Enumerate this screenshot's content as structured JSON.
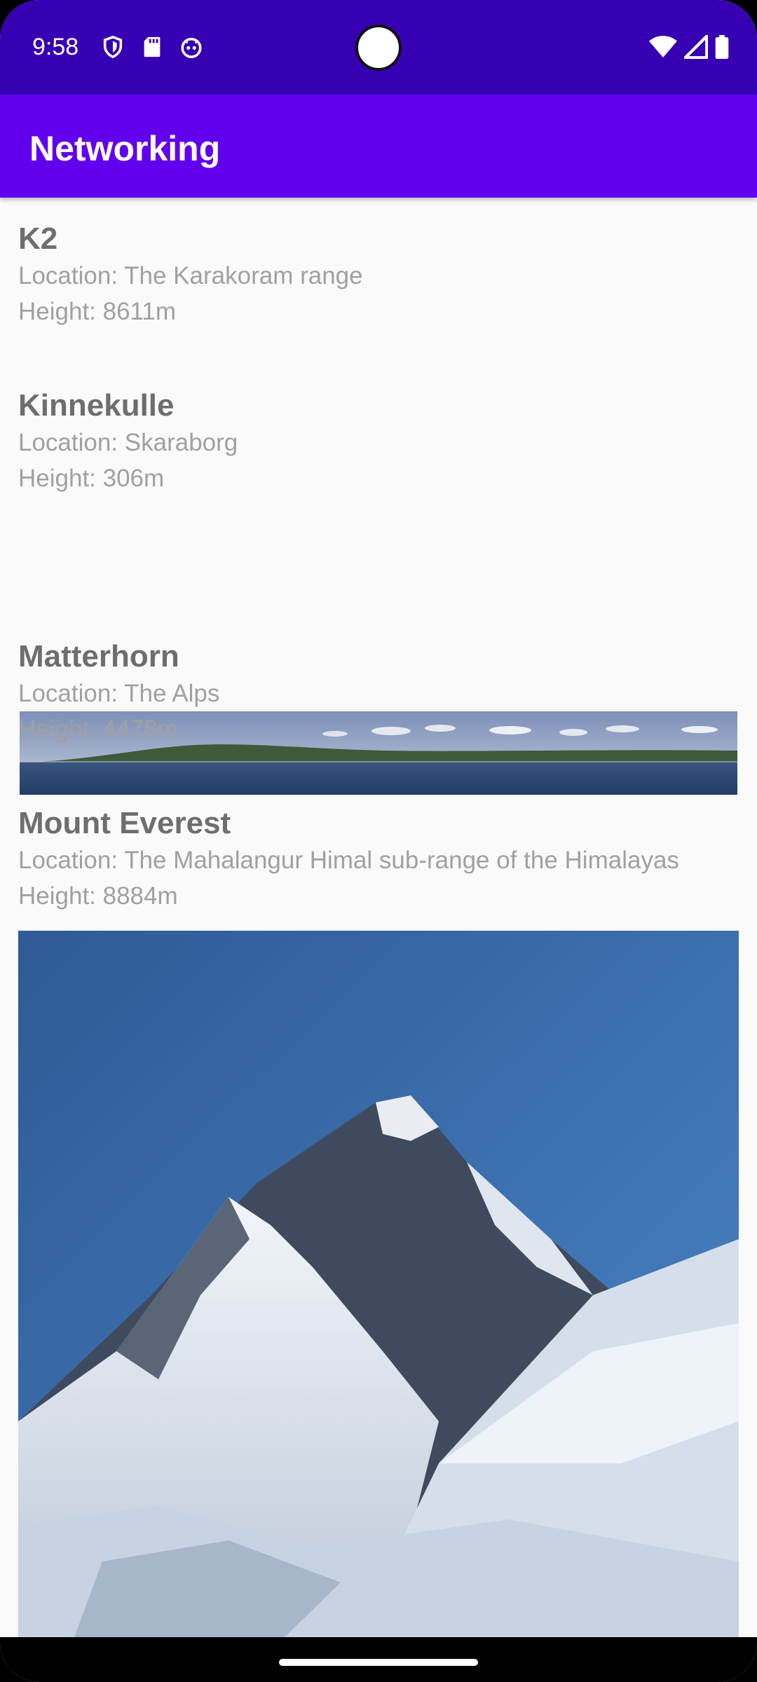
{
  "status_bar": {
    "time": "9:58",
    "left_icons": [
      "shield-icon",
      "sd-card-icon",
      "robot-face-icon"
    ],
    "right_icons": [
      "wifi-icon",
      "cell-signal-icon",
      "battery-icon"
    ]
  },
  "app_bar": {
    "title": "Networking",
    "color": "#6200ee"
  },
  "mountains": [
    {
      "name": "K2",
      "location": "Location: The Karakoram range",
      "height": "Height: 8611m",
      "has_image": false
    },
    {
      "name": "Kinnekulle",
      "location": "Location: Skaraborg",
      "height": "Height: 306m",
      "has_image": true
    },
    {
      "name": "Matterhorn",
      "location": "Location: The Alps",
      "height": "Height: 4478m",
      "has_image": false
    },
    {
      "name": "Mount Everest",
      "location": "Location: The Mahalangur Himal sub-range of the Himalayas",
      "height": "Height: 8884m",
      "has_image": true
    }
  ],
  "colors": {
    "status_bar": "#3700b3",
    "background": "#fafafa",
    "title_text": "#6e6e6e",
    "detail_text": "#a0a0a0"
  }
}
